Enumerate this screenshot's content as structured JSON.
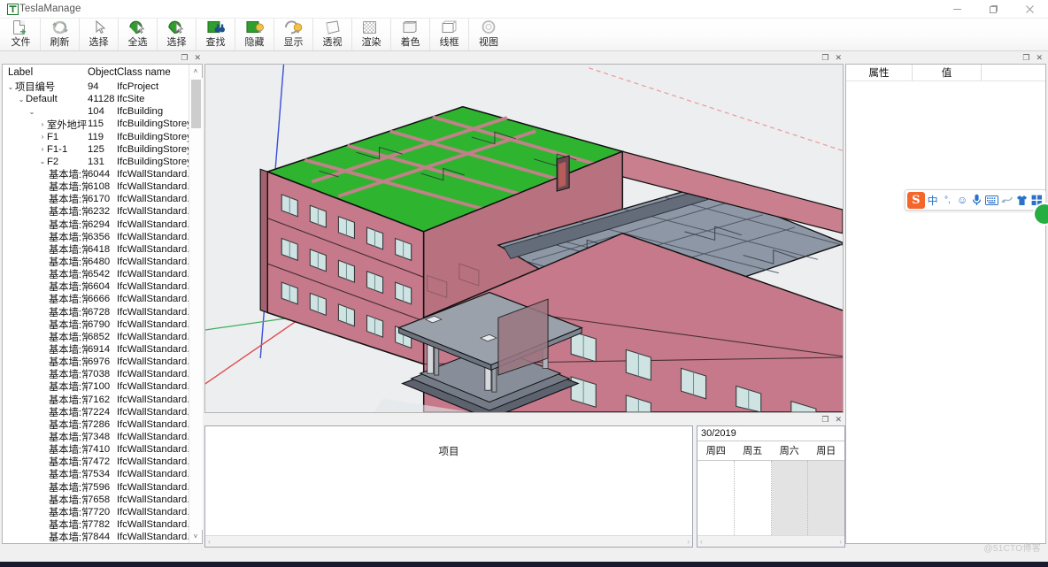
{
  "window": {
    "title": "TeslaManage",
    "logo_text": "T",
    "controls": [
      {
        "name": "minimize",
        "glyph": "—"
      },
      {
        "name": "maximize",
        "glyph": "❐"
      },
      {
        "name": "close",
        "glyph": "✕"
      }
    ]
  },
  "toolbar": {
    "items": [
      {
        "label": "文件",
        "icon": "new-file-icon"
      },
      {
        "label": "刷新",
        "icon": "refresh-icon"
      },
      {
        "label": "选择",
        "icon": "select-cursor-icon"
      },
      {
        "label": "全选",
        "icon": "select-all-icon"
      },
      {
        "label": "选择",
        "icon": "select-object-icon"
      },
      {
        "label": "查找",
        "icon": "find-binoculars-icon"
      },
      {
        "label": "隐藏",
        "icon": "hide-icon"
      },
      {
        "label": "显示",
        "icon": "show-icon"
      },
      {
        "label": "透视",
        "icon": "perspective-icon"
      },
      {
        "label": "渲染",
        "icon": "render-icon"
      },
      {
        "label": "着色",
        "icon": "shaded-icon"
      },
      {
        "label": "线框",
        "icon": "wireframe-icon"
      },
      {
        "label": "视图",
        "icon": "view-icon"
      }
    ]
  },
  "tree_panel": {
    "caption_buttons": [
      {
        "name": "float-panel",
        "glyph": "❐"
      },
      {
        "name": "close-panel",
        "glyph": "✕"
      }
    ],
    "columns": [
      "Label",
      "Object",
      "Class name"
    ],
    "rows": [
      {
        "indent": 0,
        "chevron": "⌄",
        "label": "项目编号",
        "object": "94",
        "class": "IfcProject"
      },
      {
        "indent": 1,
        "chevron": "⌄",
        "label": "Default",
        "object": "41128",
        "class": "IfcSite"
      },
      {
        "indent": 2,
        "chevron": "⌄",
        "label": "",
        "object": "104",
        "class": "IfcBuilding"
      },
      {
        "indent": 3,
        "chevron": "›",
        "label": "室外地坪",
        "object": "115",
        "class": "IfcBuildingStorey"
      },
      {
        "indent": 3,
        "chevron": "›",
        "label": "F1",
        "object": "119",
        "class": "IfcBuildingStorey"
      },
      {
        "indent": 3,
        "chevron": "›",
        "label": "F1-1",
        "object": "125",
        "class": "IfcBuildingStorey"
      },
      {
        "indent": 3,
        "chevron": "⌄",
        "label": "F2",
        "object": "131",
        "class": "IfcBuildingStorey"
      },
      {
        "indent": 4,
        "chevron": "",
        "label": "基本墙:常...",
        "object": "6044",
        "class": "IfcWallStandard..."
      },
      {
        "indent": 4,
        "chevron": "",
        "label": "基本墙:常...",
        "object": "6108",
        "class": "IfcWallStandard..."
      },
      {
        "indent": 4,
        "chevron": "",
        "label": "基本墙:常...",
        "object": "6170",
        "class": "IfcWallStandard..."
      },
      {
        "indent": 4,
        "chevron": "",
        "label": "基本墙:常...",
        "object": "6232",
        "class": "IfcWallStandard..."
      },
      {
        "indent": 4,
        "chevron": "",
        "label": "基本墙:常...",
        "object": "6294",
        "class": "IfcWallStandard..."
      },
      {
        "indent": 4,
        "chevron": "",
        "label": "基本墙:常...",
        "object": "6356",
        "class": "IfcWallStandard..."
      },
      {
        "indent": 4,
        "chevron": "",
        "label": "基本墙:常...",
        "object": "6418",
        "class": "IfcWallStandard..."
      },
      {
        "indent": 4,
        "chevron": "",
        "label": "基本墙:常...",
        "object": "6480",
        "class": "IfcWallStandard..."
      },
      {
        "indent": 4,
        "chevron": "",
        "label": "基本墙:常...",
        "object": "6542",
        "class": "IfcWallStandard..."
      },
      {
        "indent": 4,
        "chevron": "",
        "label": "基本墙:常...",
        "object": "6604",
        "class": "IfcWallStandard..."
      },
      {
        "indent": 4,
        "chevron": "",
        "label": "基本墙:常...",
        "object": "6666",
        "class": "IfcWallStandard..."
      },
      {
        "indent": 4,
        "chevron": "",
        "label": "基本墙:常...",
        "object": "6728",
        "class": "IfcWallStandard..."
      },
      {
        "indent": 4,
        "chevron": "",
        "label": "基本墙:常...",
        "object": "6790",
        "class": "IfcWallStandard..."
      },
      {
        "indent": 4,
        "chevron": "",
        "label": "基本墙:常...",
        "object": "6852",
        "class": "IfcWallStandard..."
      },
      {
        "indent": 4,
        "chevron": "",
        "label": "基本墙:常...",
        "object": "6914",
        "class": "IfcWallStandard..."
      },
      {
        "indent": 4,
        "chevron": "",
        "label": "基本墙:常...",
        "object": "6976",
        "class": "IfcWallStandard..."
      },
      {
        "indent": 4,
        "chevron": "",
        "label": "基本墙:常...",
        "object": "7038",
        "class": "IfcWallStandard..."
      },
      {
        "indent": 4,
        "chevron": "",
        "label": "基本墙:常...",
        "object": "7100",
        "class": "IfcWallStandard..."
      },
      {
        "indent": 4,
        "chevron": "",
        "label": "基本墙:常...",
        "object": "7162",
        "class": "IfcWallStandard..."
      },
      {
        "indent": 4,
        "chevron": "",
        "label": "基本墙:常...",
        "object": "7224",
        "class": "IfcWallStandard..."
      },
      {
        "indent": 4,
        "chevron": "",
        "label": "基本墙:常...",
        "object": "7286",
        "class": "IfcWallStandard..."
      },
      {
        "indent": 4,
        "chevron": "",
        "label": "基本墙:常...",
        "object": "7348",
        "class": "IfcWallStandard..."
      },
      {
        "indent": 4,
        "chevron": "",
        "label": "基本墙:常...",
        "object": "7410",
        "class": "IfcWallStandard..."
      },
      {
        "indent": 4,
        "chevron": "",
        "label": "基本墙:常...",
        "object": "7472",
        "class": "IfcWallStandard..."
      },
      {
        "indent": 4,
        "chevron": "",
        "label": "基本墙:常...",
        "object": "7534",
        "class": "IfcWallStandard..."
      },
      {
        "indent": 4,
        "chevron": "",
        "label": "基本墙:常...",
        "object": "7596",
        "class": "IfcWallStandard..."
      },
      {
        "indent": 4,
        "chevron": "",
        "label": "基本墙:常...",
        "object": "7658",
        "class": "IfcWallStandard..."
      },
      {
        "indent": 4,
        "chevron": "",
        "label": "基本墙:常...",
        "object": "7720",
        "class": "IfcWallStandard..."
      },
      {
        "indent": 4,
        "chevron": "",
        "label": "基本墙:常...",
        "object": "7782",
        "class": "IfcWallStandard..."
      },
      {
        "indent": 4,
        "chevron": "",
        "label": "基本墙:常...",
        "object": "7844",
        "class": "IfcWallStandard..."
      }
    ],
    "scroll_up_glyph": "˄",
    "scroll_down_glyph": "˅"
  },
  "viewport": {
    "caption_buttons": [
      {
        "name": "float-panel",
        "glyph": "❐"
      },
      {
        "name": "close-panel",
        "glyph": "✕"
      }
    ],
    "colors": {
      "background": "#eceef0",
      "wall": "#c97f8e",
      "wall_dark": "#b8717f",
      "roof_slab": "#2fb42f",
      "floor_slab": "#8e97a5",
      "window_glass": "#cfe3e3",
      "axis_blue": "#3b4fd8",
      "axis_red": "#e04848",
      "axis_green": "#3fae5e",
      "outline": "#111111"
    }
  },
  "project_panel": {
    "caption_buttons": [
      {
        "name": "float-panel",
        "glyph": "❐"
      },
      {
        "name": "close-panel",
        "glyph": "✕"
      }
    ],
    "title": "项目",
    "scroll_left_glyph": "‹",
    "scroll_right_glyph": "›"
  },
  "calendar": {
    "date": "30/2019",
    "weekdays": [
      {
        "label": "周四",
        "weekend": false
      },
      {
        "label": "周五",
        "weekend": false
      },
      {
        "label": "周六",
        "weekend": true
      },
      {
        "label": "周日",
        "weekend": true
      }
    ],
    "scroll_left_glyph": "‹",
    "scroll_right_glyph": "›"
  },
  "properties_panel": {
    "caption_buttons": [
      {
        "name": "float-panel",
        "glyph": "❐"
      },
      {
        "name": "close-panel",
        "glyph": "✕"
      }
    ],
    "columns": [
      "属性",
      "值",
      ""
    ]
  },
  "ime_bar": {
    "logo": "S",
    "items": [
      {
        "name": "chinese-mode-icon",
        "glyph": "中"
      },
      {
        "name": "punctuation-icon",
        "glyph": "°,"
      },
      {
        "name": "emoji-icon",
        "glyph": "☺"
      },
      {
        "name": "voice-input-icon",
        "glyph": "⬤"
      },
      {
        "name": "keyboard-icon",
        "glyph": "⌨"
      },
      {
        "name": "handwriting-icon",
        "glyph": "✎"
      },
      {
        "name": "skin-icon",
        "glyph": "⬟"
      },
      {
        "name": "toolbox-icon",
        "glyph": "⊞"
      }
    ]
  },
  "status": {
    "watermark": "@51CTO博客"
  }
}
